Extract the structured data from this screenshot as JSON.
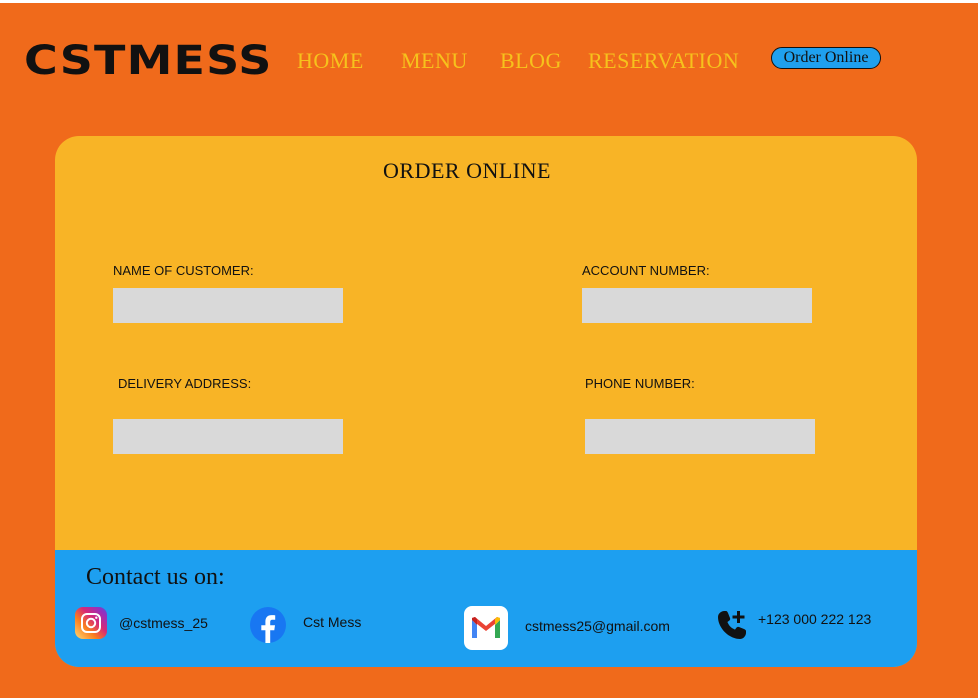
{
  "brand": {
    "logo_text": "CSTMESS"
  },
  "nav": {
    "home": "HOME",
    "menu": "MENU",
    "blog": "BLOG",
    "reservation": "RESERVATION",
    "order_button": "Order Online"
  },
  "form": {
    "title": "ORDER ONLINE",
    "name_label": "NAME OF CUSTOMER:",
    "account_label": "ACCOUNT NUMBER:",
    "address_label": "DELIVERY ADDRESS:",
    "phone_label": "PHONE NUMBER:",
    "name_value": "",
    "account_value": "",
    "address_value": "",
    "phone_value": ""
  },
  "footer": {
    "title": "Contact us on:",
    "instagram": "@cstmess_25",
    "facebook": "Cst Mess",
    "email": "cstmess25@gmail.com",
    "phone": "+123 000 222 123",
    "icons": [
      "instagram-icon",
      "facebook-icon",
      "gmail-icon",
      "phone-add-icon"
    ]
  },
  "colors": {
    "background": "#f06a1b",
    "nav_text": "#f6c21c",
    "card": "#f8b426",
    "footer": "#1d9ff0",
    "input": "#d9d9d9",
    "order_button": "#1fa0ee"
  }
}
